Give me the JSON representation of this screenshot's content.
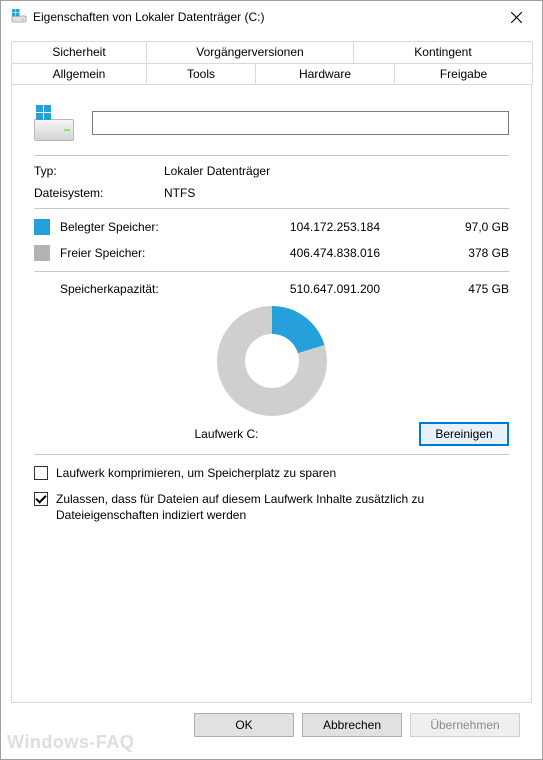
{
  "window": {
    "title": "Eigenschaften von Lokaler Datenträger (C:)"
  },
  "tabs": {
    "back": [
      "Sicherheit",
      "Vorgängerversionen",
      "Kontingent"
    ],
    "front": [
      "Allgemein",
      "Tools",
      "Hardware",
      "Freigabe"
    ],
    "active": "Allgemein"
  },
  "general": {
    "name_value": "",
    "type_label": "Typ:",
    "type_value": "Lokaler Datenträger",
    "fs_label": "Dateisystem:",
    "fs_value": "NTFS",
    "used_label": "Belegter Speicher:",
    "used_bytes": "104.172.253.184",
    "used_hr": "97,0 GB",
    "free_label": "Freier Speicher:",
    "free_bytes": "406.474.838.016",
    "free_hr": "378 GB",
    "cap_label": "Speicherkapazität:",
    "cap_bytes": "510.647.091.200",
    "cap_hr": "475 GB",
    "drive_label": "Laufwerk C:",
    "cleanup_button": "Bereinigen",
    "compress_label": "Laufwerk komprimieren, um Speicherplatz zu sparen",
    "index_label": "Zulassen, dass für Dateien auf diesem Laufwerk Inhalte zusätzlich zu Dateieigenschaften indiziert werden",
    "compress_checked": false,
    "index_checked": true
  },
  "buttons": {
    "ok": "OK",
    "cancel": "Abbrechen",
    "apply": "Übernehmen"
  },
  "colors": {
    "used": "#26a0da",
    "free": "#b3b3b3",
    "accent": "#0078d7"
  },
  "chart_data": {
    "type": "pie",
    "title": "Laufwerk C:",
    "series": [
      {
        "name": "Belegter Speicher",
        "value_bytes": 104172253184,
        "value_hr": "97,0 GB",
        "color": "#26a0da"
      },
      {
        "name": "Freier Speicher",
        "value_bytes": 406474838016,
        "value_hr": "378 GB",
        "color": "#b3b3b3"
      }
    ],
    "total_bytes": 510647091200,
    "total_hr": "475 GB"
  },
  "watermark": "Windows-FAQ"
}
